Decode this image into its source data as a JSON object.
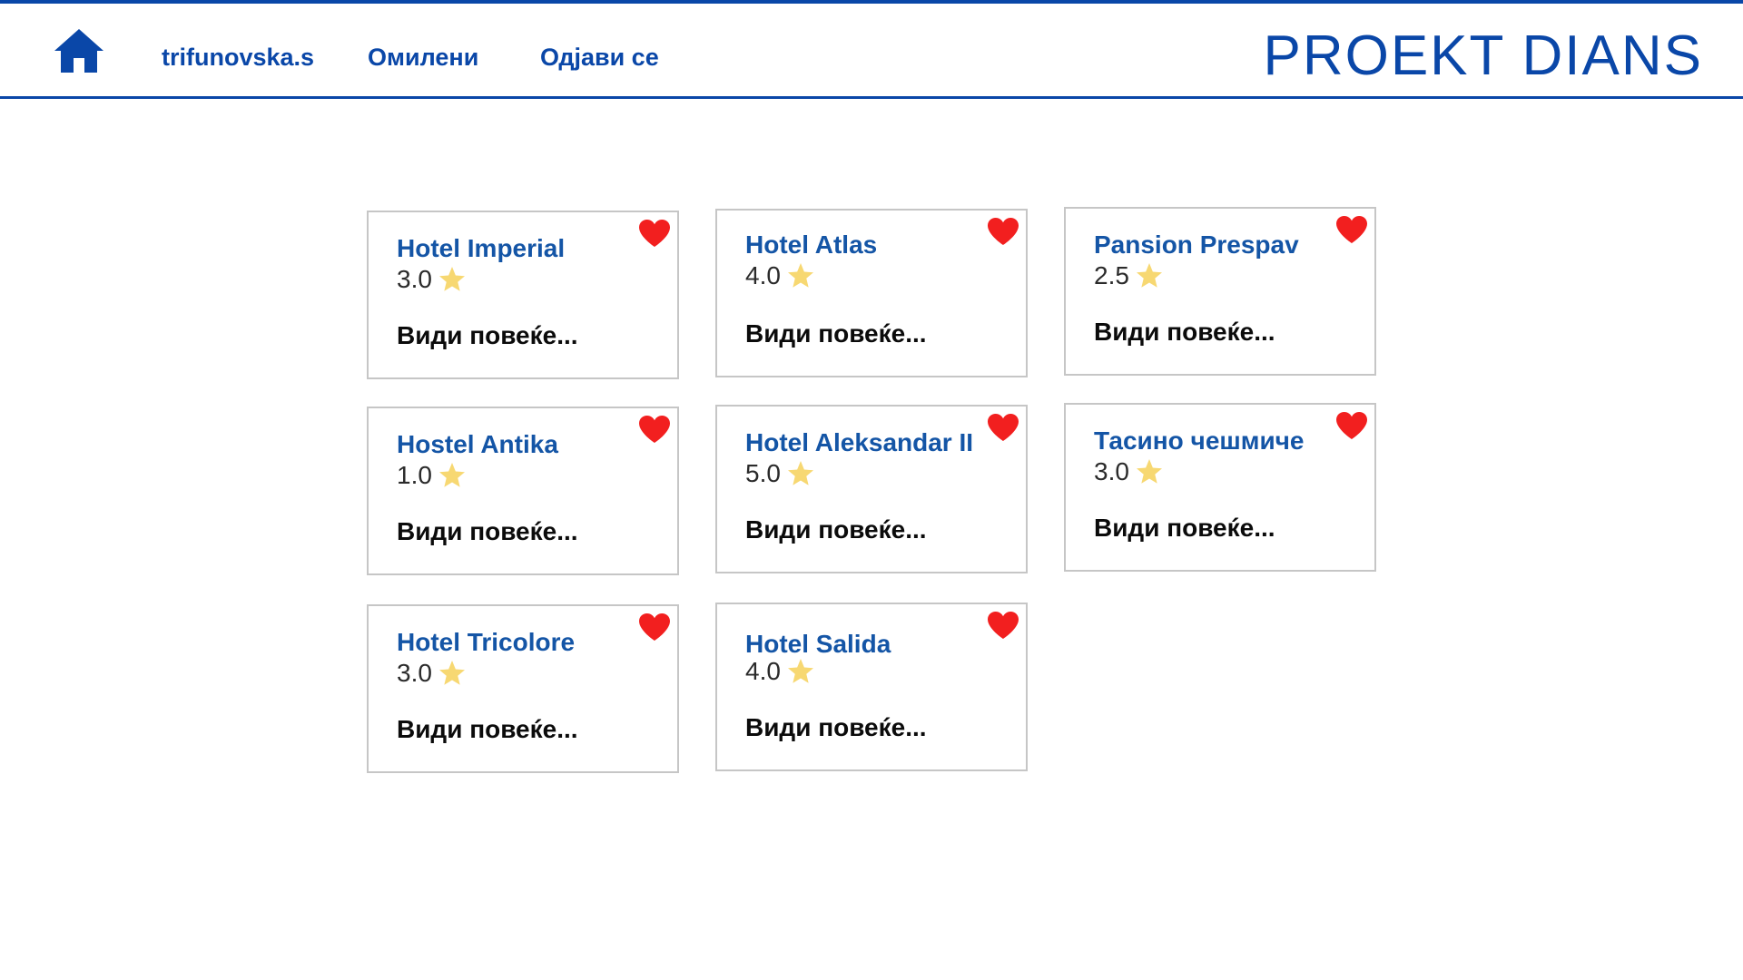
{
  "header": {
    "username": "trifunovska.s",
    "favorites_label": "Омилени",
    "logout_label": "Одјави се",
    "brand": "PROEKT DIANS"
  },
  "colors": {
    "accent": "#0a47a8",
    "title_blue": "#1455a6",
    "heart": "#f21f1f",
    "star": "#f7d872"
  },
  "hotels": [
    {
      "name": "Hotel Imperial",
      "rating": "3.0",
      "more": "Види повеќе..."
    },
    {
      "name": "Hotel Atlas",
      "rating": "4.0",
      "more": "Види повеќе..."
    },
    {
      "name": "Pansion Prespav",
      "rating": "2.5",
      "more": "Види повеќе..."
    },
    {
      "name": "Hostel Antika",
      "rating": "1.0",
      "more": "Види повеќе..."
    },
    {
      "name": "Hotel Aleksandar II",
      "rating": "5.0",
      "more": "Види повеќе..."
    },
    {
      "name": "Тасино чешмиче",
      "rating": "3.0",
      "more": "Види повеќе..."
    },
    {
      "name": "Hotel Tricolore",
      "rating": "3.0",
      "more": "Види повеќе..."
    },
    {
      "name": "Hotel  Salida",
      "rating": "4.0",
      "more": "Види повеќе..."
    }
  ]
}
